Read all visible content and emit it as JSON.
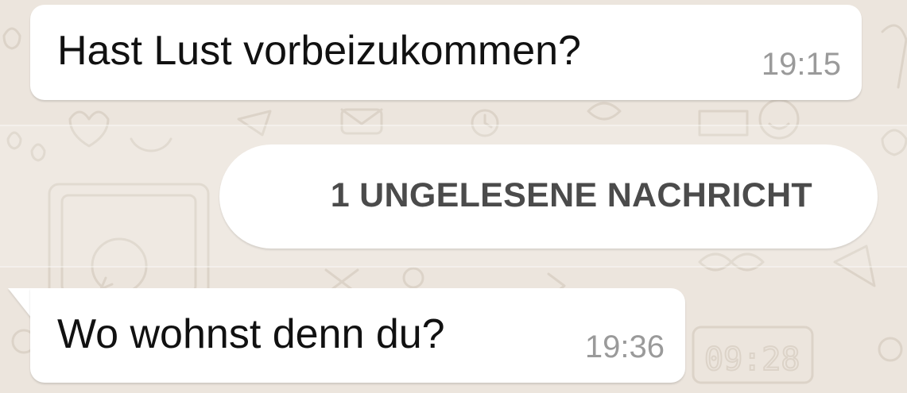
{
  "chat": {
    "messages": [
      {
        "text": "Hast Lust vorbeizukommen?",
        "time": "19:15"
      },
      {
        "text": "Wo wohnst denn du?",
        "time": "19:36"
      }
    ],
    "unread_divider": "1 UNGELESENE NACHRICHT"
  },
  "wallpaper": {
    "clock_doodle": "09:28"
  },
  "colors": {
    "background": "#ece5dd",
    "bubble": "#ffffff",
    "message_text": "#111111",
    "timestamp": "#9a9a9a",
    "divider_text": "#4b4b4b"
  }
}
